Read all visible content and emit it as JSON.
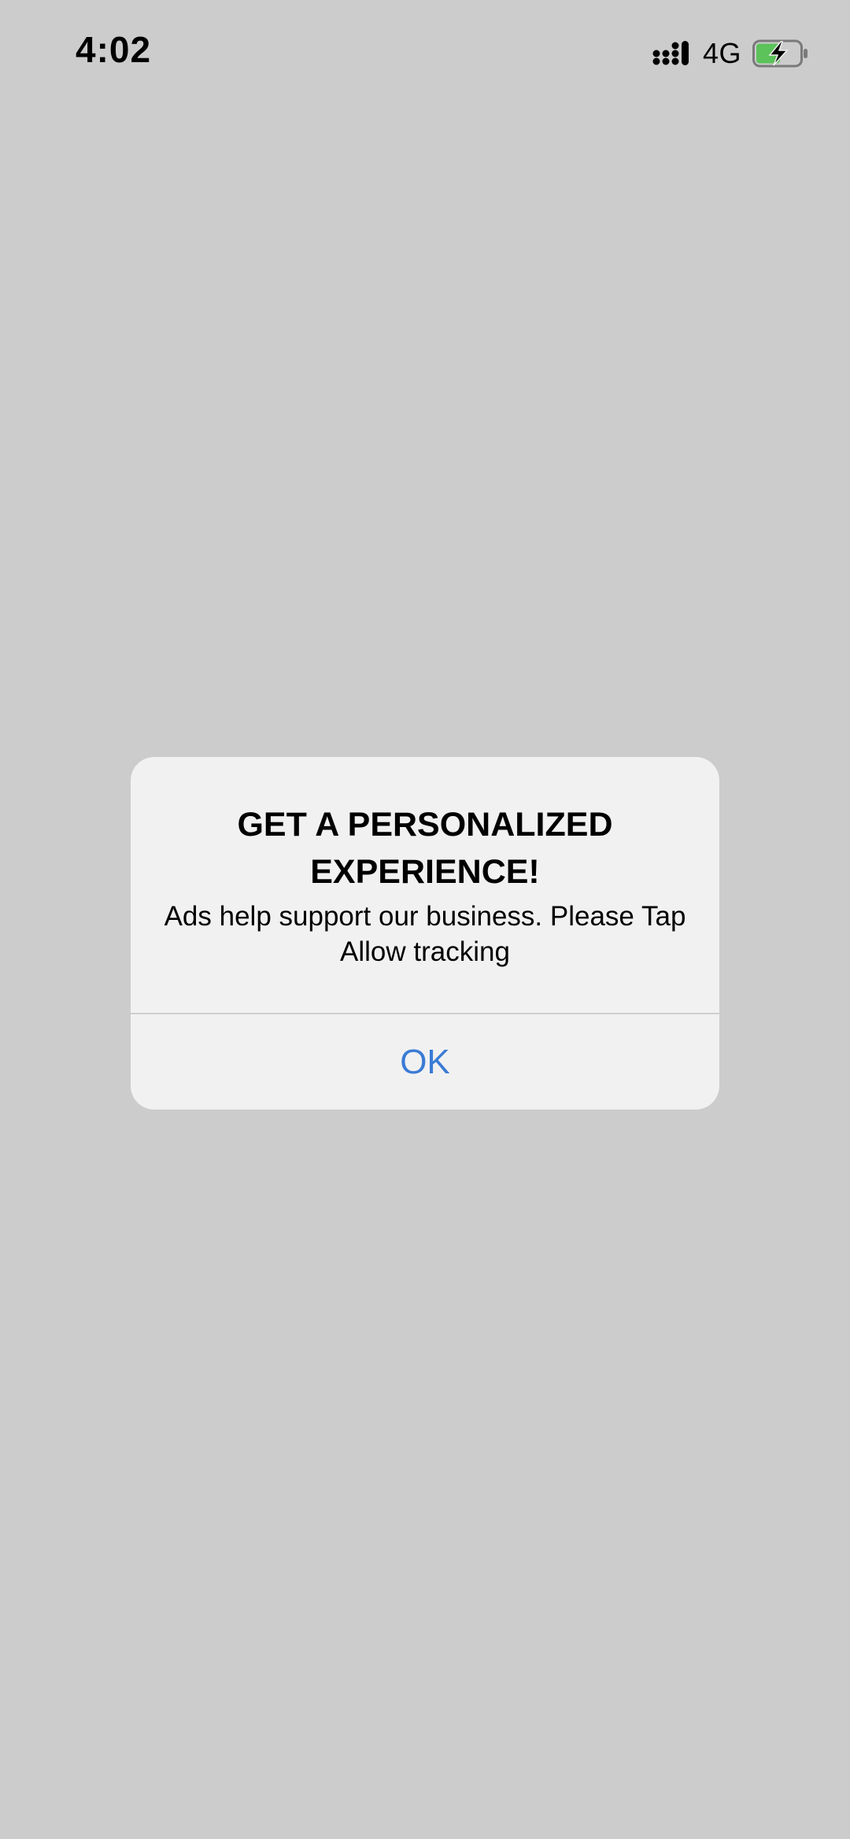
{
  "status_bar": {
    "time": "4:02",
    "network": "4G",
    "icons": [
      "signal-icon",
      "battery-charging-icon"
    ],
    "battery_color": "#5cc25a"
  },
  "dialog": {
    "title": "GET A PERSONALIZED EXPERIENCE!",
    "message": "Ads help support our business. Please Tap Allow tracking",
    "button_label": "OK",
    "button_color": "#3a7bd5"
  }
}
